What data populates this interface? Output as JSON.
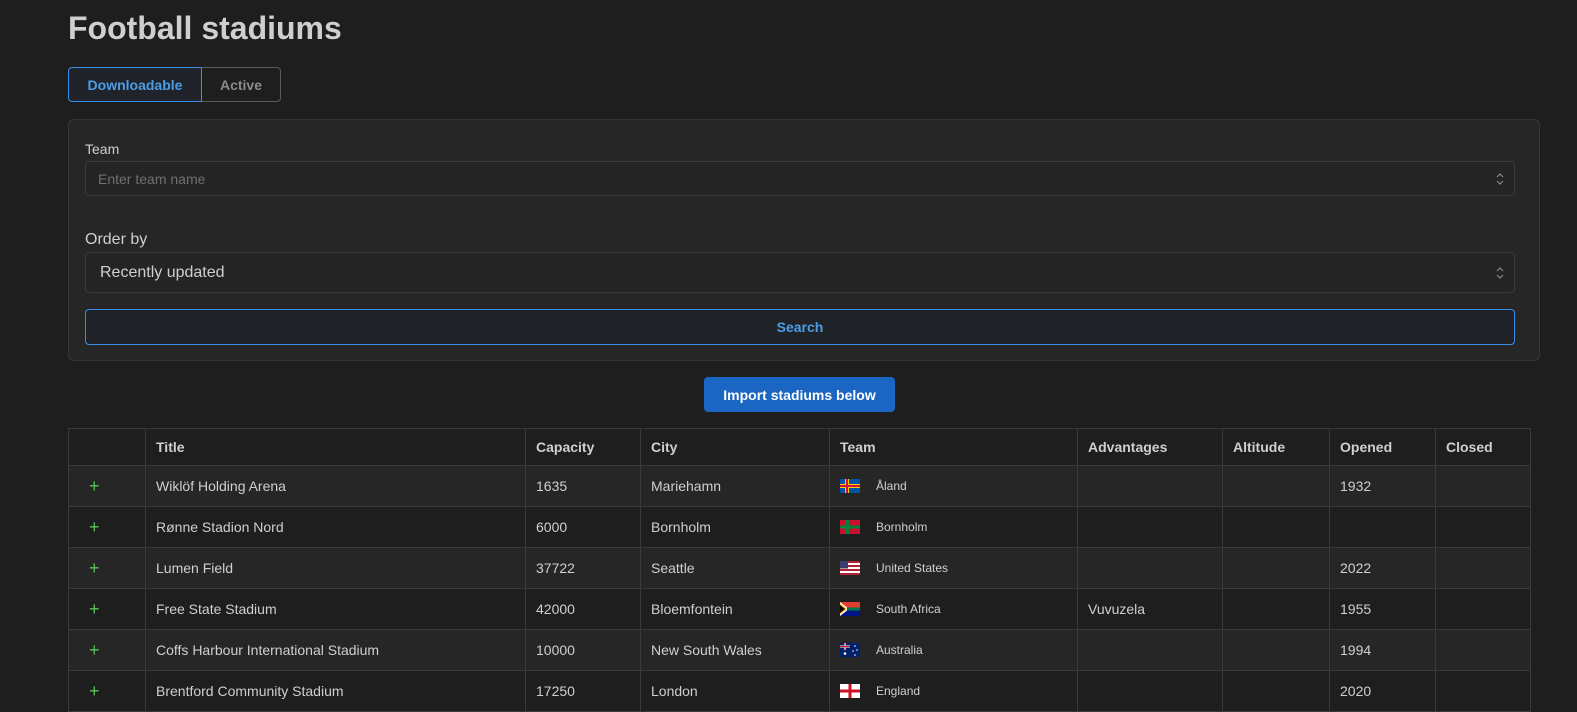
{
  "page": {
    "title": "Football stadiums"
  },
  "tabs": [
    {
      "label": "Downloadable",
      "active": true
    },
    {
      "label": "Active",
      "active": false
    }
  ],
  "filters": {
    "team_label": "Team",
    "team_placeholder": "Enter team name",
    "team_value": "",
    "order_label": "Order by",
    "order_value": "Recently updated",
    "search_label": "Search"
  },
  "import_label": "Import stadiums below",
  "table": {
    "columns": [
      "",
      "Title",
      "Capacity",
      "City",
      "Team",
      "Advantages",
      "Altitude",
      "Opened",
      "Closed"
    ],
    "add_symbol": "+",
    "rows": [
      {
        "title": "Wiklöf Holding Arena",
        "capacity": "1635",
        "city": "Mariehamn",
        "team": "Åland",
        "flag": "aland-flag-icon",
        "advantages": "",
        "altitude": "",
        "opened": "1932",
        "closed": ""
      },
      {
        "title": "Rønne Stadion Nord",
        "capacity": "6000",
        "city": "Bornholm",
        "team": "Bornholm",
        "flag": "bornholm-flag-icon",
        "advantages": "",
        "altitude": "",
        "opened": "",
        "closed": ""
      },
      {
        "title": "Lumen Field",
        "capacity": "37722",
        "city": "Seattle",
        "team": "United States",
        "flag": "usa-flag-icon",
        "advantages": "",
        "altitude": "",
        "opened": "2022",
        "closed": ""
      },
      {
        "title": "Free State Stadium",
        "capacity": "42000",
        "city": "Bloemfontein",
        "team": "South Africa",
        "flag": "south-africa-flag-icon",
        "advantages": "Vuvuzela",
        "altitude": "",
        "opened": "1955",
        "closed": ""
      },
      {
        "title": "Coffs Harbour International Stadium",
        "capacity": "10000",
        "city": "New South Wales",
        "team": "Australia",
        "flag": "australia-flag-icon",
        "advantages": "",
        "altitude": "",
        "opened": "1994",
        "closed": ""
      },
      {
        "title": "Brentford Community Stadium",
        "capacity": "17250",
        "city": "London",
        "team": "England",
        "flag": "england-flag-icon",
        "advantages": "",
        "altitude": "",
        "opened": "2020",
        "closed": ""
      }
    ]
  },
  "colors": {
    "background": "#1e1e1e",
    "accent": "#3a8ee6",
    "primary_button": "#1a66c2",
    "add_icon": "#5cc15c"
  }
}
